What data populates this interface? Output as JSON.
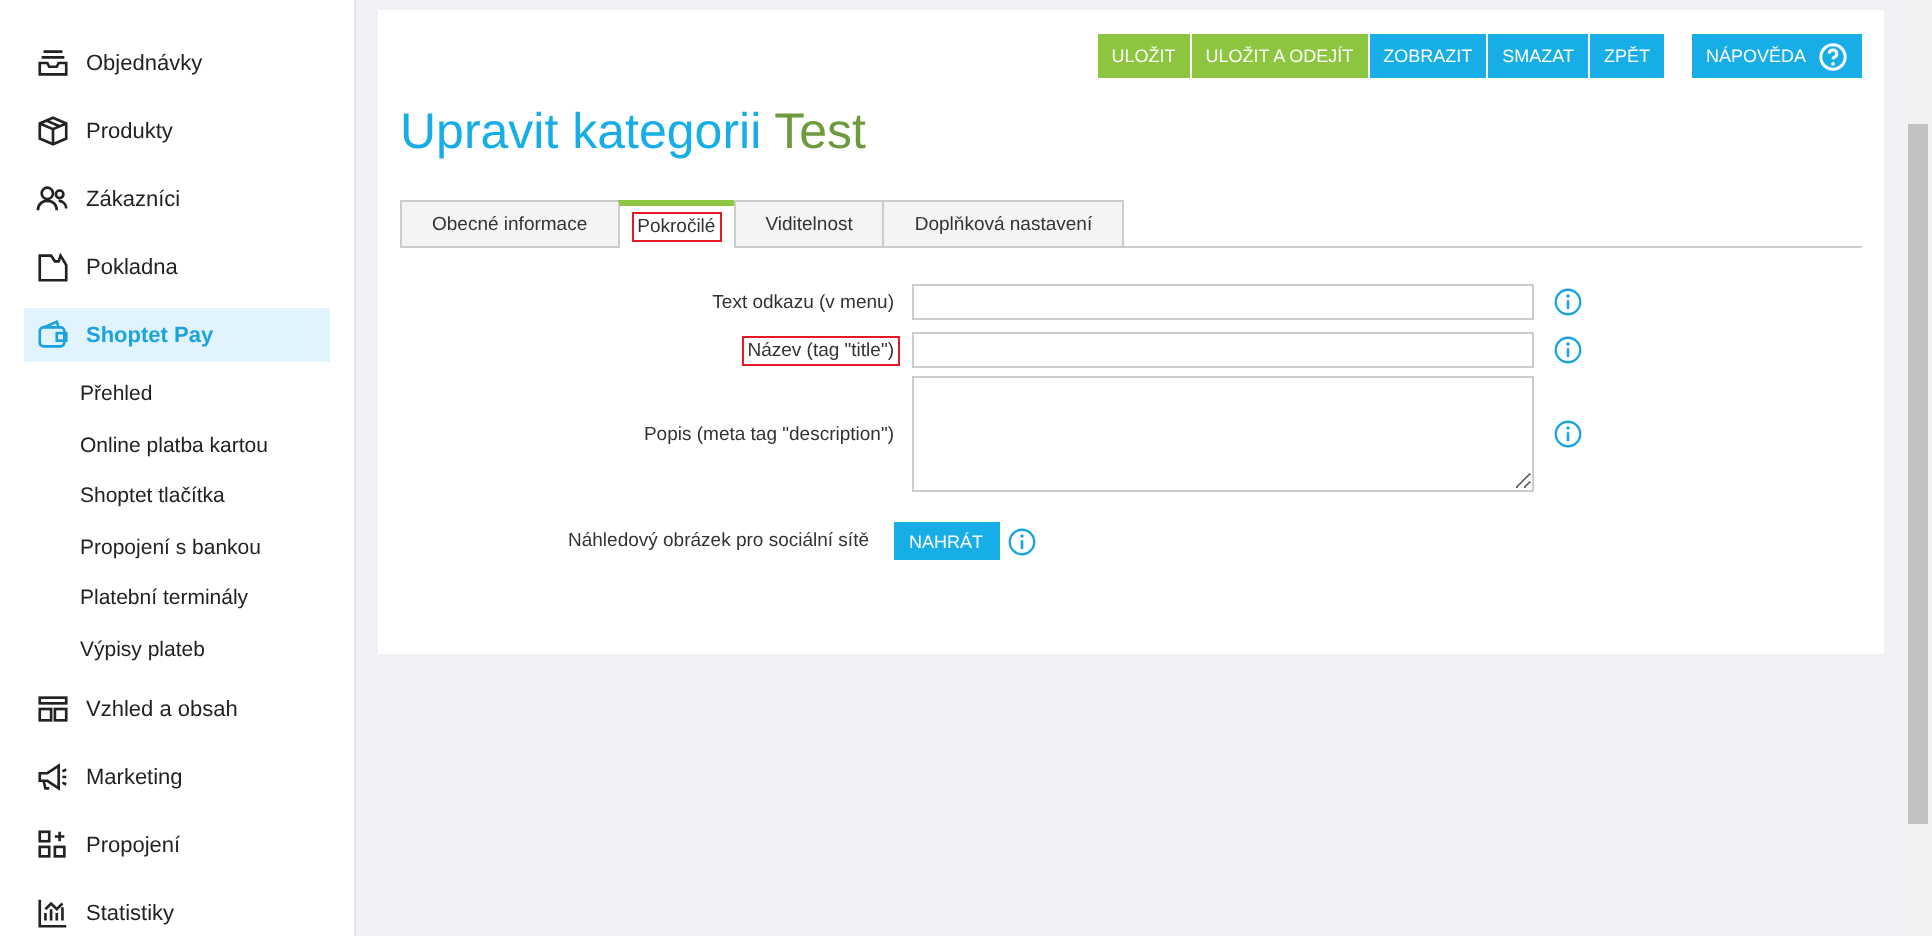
{
  "sidebar": {
    "items": [
      {
        "label": "Objednávky",
        "selected": false
      },
      {
        "label": "Produkty",
        "selected": false
      },
      {
        "label": "Zákazníci",
        "selected": false
      },
      {
        "label": "Pokladna",
        "selected": false
      },
      {
        "label": "Shoptet Pay",
        "selected": true,
        "children": [
          {
            "label": "Přehled"
          },
          {
            "label": "Online platba kartou"
          },
          {
            "label": "Shoptet tlačítka"
          },
          {
            "label": "Propojení s bankou"
          },
          {
            "label": "Platební terminály"
          },
          {
            "label": "Výpisy plateb"
          }
        ]
      },
      {
        "label": "Vzhled a obsah",
        "selected": false
      },
      {
        "label": "Marketing",
        "selected": false
      },
      {
        "label": "Propojení",
        "selected": false
      },
      {
        "label": "Statistiky",
        "selected": false
      }
    ]
  },
  "toolbar": [
    {
      "label": "ULOŽIT",
      "kind": "save"
    },
    {
      "label": "ULOŽIT A ODEJÍT",
      "kind": "save"
    },
    {
      "label": "ZOBRAZIT",
      "kind": "action"
    },
    {
      "label": "SMAZAT",
      "kind": "action"
    },
    {
      "label": "ZPĚT",
      "kind": "action"
    },
    {
      "label": "NÁPOVĚDA",
      "kind": "help"
    }
  ],
  "page": {
    "title": "Upravit kategorii",
    "name": "Test"
  },
  "tabs": [
    {
      "label": "Obecné informace",
      "selected": false,
      "highlighted": false
    },
    {
      "label": "Pokročilé",
      "selected": true,
      "highlighted": true
    },
    {
      "label": "Viditelnost",
      "selected": false,
      "highlighted": false
    },
    {
      "label": "Doplňková nastavení",
      "selected": false,
      "highlighted": false
    }
  ],
  "form": [
    {
      "label": "Text odkazu (v menu)",
      "kind": "input",
      "highlighted": false
    },
    {
      "label": "Název (tag \"title\")",
      "kind": "input",
      "highlighted": true
    },
    {
      "label": "Popis (meta tag \"description\")",
      "kind": "textarea",
      "highlighted": false
    },
    {
      "label": "Náhledový obrázek pro sociální sítě",
      "kind": "upload",
      "highlighted": false,
      "button": "NAHRÁT"
    }
  ]
}
